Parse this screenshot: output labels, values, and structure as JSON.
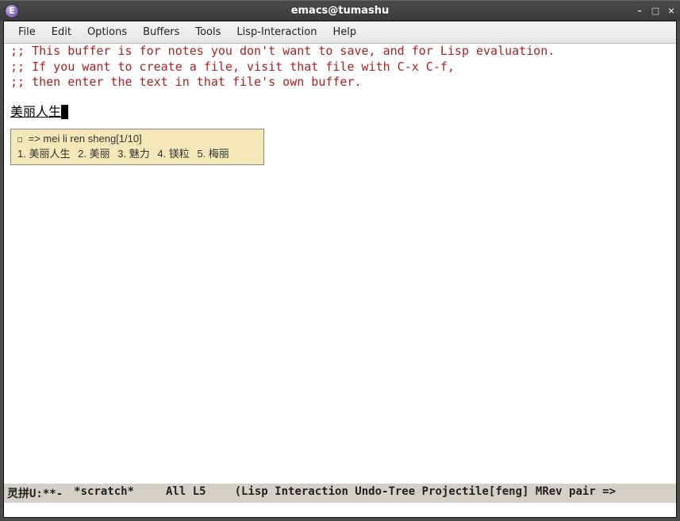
{
  "titlebar": {
    "app_icon_glyph": "E",
    "title": "emacs@tumashu"
  },
  "menubar": {
    "items": [
      "File",
      "Edit",
      "Options",
      "Buffers",
      "Tools",
      "Lisp-Interaction",
      "Help"
    ]
  },
  "editor": {
    "comment_lines": [
      ";; This buffer is for notes you don't want to save, and for Lisp evaluation.",
      ";; If you want to create a file, visit that file with C-x C-f,",
      ";; then enter the text in that file's own buffer."
    ],
    "input_text": "美丽人生"
  },
  "ime": {
    "preedit": "=> mei li ren sheng[1/10]",
    "candidates": [
      {
        "num": "1.",
        "text": "美丽人生"
      },
      {
        "num": "2.",
        "text": "美丽"
      },
      {
        "num": "3.",
        "text": "魅力"
      },
      {
        "num": "4.",
        "text": "镁粒"
      },
      {
        "num": "5.",
        "text": "梅丽"
      }
    ]
  },
  "modeline": {
    "left": "灵拼U:**-",
    "buffer": "*scratch*",
    "position": "All L5",
    "modes": "(Lisp Interaction Undo-Tree Projectile[feng] MRev pair =>"
  }
}
